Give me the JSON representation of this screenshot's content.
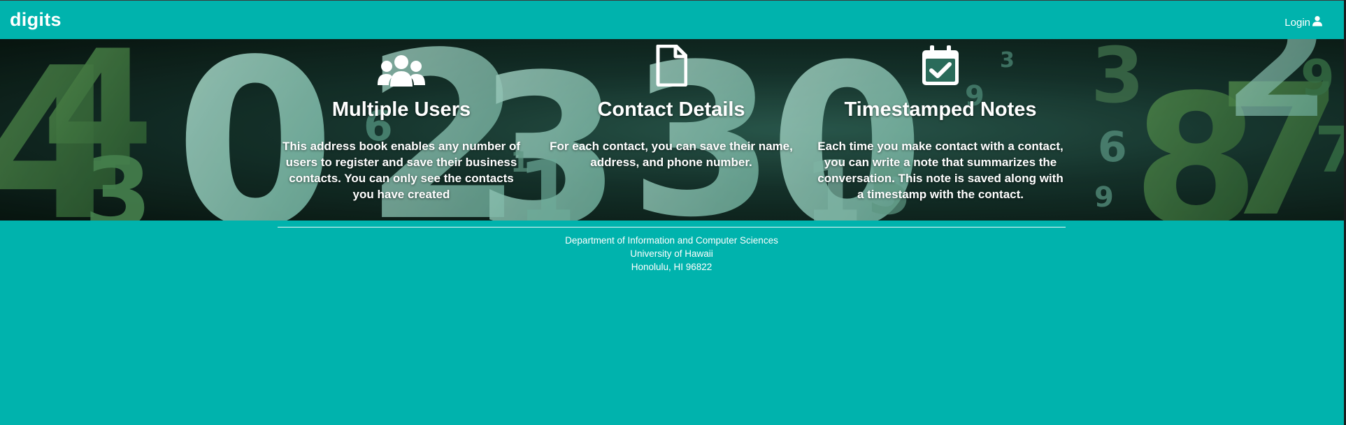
{
  "navbar": {
    "brand": "digits",
    "login_label": "Login",
    "icons": {
      "login": "user-icon"
    }
  },
  "features": [
    {
      "icon": "users-icon",
      "title": "Multiple Users",
      "text": "This address book enables any number of users to register and save their business contacts. You can only see the contacts you have created"
    },
    {
      "icon": "file-icon",
      "title": "Contact Details",
      "text": "For each contact, you can save their name, address, and phone number."
    },
    {
      "icon": "calendar-check-icon",
      "title": "Timestamped Notes",
      "text": "Each time you make contact with a contact, you can write a note that summarizes the conversation. This note is saved along with a timestamp with the contact."
    }
  ],
  "footer": {
    "line1": "Department of Information and Computer Sciences",
    "line2": "University of Hawaii",
    "line3": "Honolulu, HI 96822"
  },
  "colors": {
    "page_background": "#00b3ad",
    "text": "#ffffff",
    "hero_digit_light": "#9fd9c9",
    "hero_digit_dark": "#3e7a45"
  }
}
